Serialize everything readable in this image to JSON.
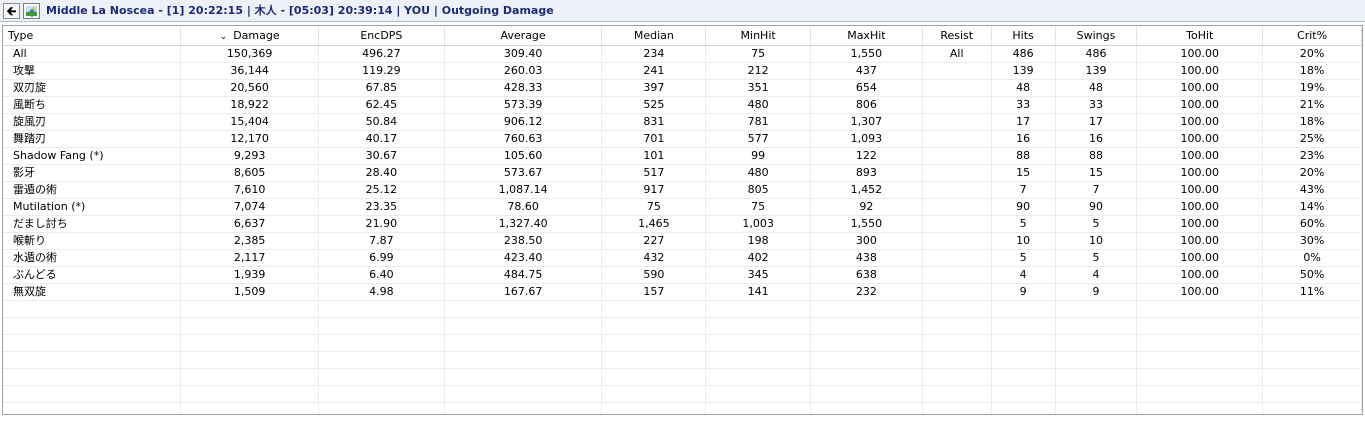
{
  "title": "Middle La Noscea - [1] 20:22:15 | 木人 - [05:03] 20:39:14 | YOU | Outgoing Damage",
  "icons": {
    "back": "back-arrow-icon",
    "image": "image-icon"
  },
  "columns": [
    "Type",
    "Damage",
    "EncDPS",
    "Average",
    "Median",
    "MinHit",
    "MaxHit",
    "Resist",
    "Hits",
    "Swings",
    "ToHit",
    "Crit%"
  ],
  "sorted_column": "Damage",
  "rows": [
    [
      "All",
      "150,369",
      "496.27",
      "309.40",
      "234",
      "75",
      "1,550",
      "All",
      "486",
      "486",
      "100.00",
      "20%"
    ],
    [
      "攻撃",
      "36,144",
      "119.29",
      "260.03",
      "241",
      "212",
      "437",
      "",
      "139",
      "139",
      "100.00",
      "18%"
    ],
    [
      "双刃旋",
      "20,560",
      "67.85",
      "428.33",
      "397",
      "351",
      "654",
      "",
      "48",
      "48",
      "100.00",
      "19%"
    ],
    [
      "風断ち",
      "18,922",
      "62.45",
      "573.39",
      "525",
      "480",
      "806",
      "",
      "33",
      "33",
      "100.00",
      "21%"
    ],
    [
      "旋風刃",
      "15,404",
      "50.84",
      "906.12",
      "831",
      "781",
      "1,307",
      "",
      "17",
      "17",
      "100.00",
      "18%"
    ],
    [
      "舞踏刃",
      "12,170",
      "40.17",
      "760.63",
      "701",
      "577",
      "1,093",
      "",
      "16",
      "16",
      "100.00",
      "25%"
    ],
    [
      "Shadow Fang (*)",
      "9,293",
      "30.67",
      "105.60",
      "101",
      "99",
      "122",
      "",
      "88",
      "88",
      "100.00",
      "23%"
    ],
    [
      "影牙",
      "8,605",
      "28.40",
      "573.67",
      "517",
      "480",
      "893",
      "",
      "15",
      "15",
      "100.00",
      "20%"
    ],
    [
      "雷遁の術",
      "7,610",
      "25.12",
      "1,087.14",
      "917",
      "805",
      "1,452",
      "",
      "7",
      "7",
      "100.00",
      "43%"
    ],
    [
      "Mutilation (*)",
      "7,074",
      "23.35",
      "78.60",
      "75",
      "75",
      "92",
      "",
      "90",
      "90",
      "100.00",
      "14%"
    ],
    [
      "だまし討ち",
      "6,637",
      "21.90",
      "1,327.40",
      "1,465",
      "1,003",
      "1,550",
      "",
      "5",
      "5",
      "100.00",
      "60%"
    ],
    [
      "喉斬り",
      "2,385",
      "7.87",
      "238.50",
      "227",
      "198",
      "300",
      "",
      "10",
      "10",
      "100.00",
      "30%"
    ],
    [
      "水遁の術",
      "2,117",
      "6.99",
      "423.40",
      "432",
      "402",
      "438",
      "",
      "5",
      "5",
      "100.00",
      "0%"
    ],
    [
      "ぶんどる",
      "1,939",
      "6.40",
      "484.75",
      "590",
      "345",
      "638",
      "",
      "4",
      "4",
      "100.00",
      "50%"
    ],
    [
      "無双旋",
      "1,509",
      "4.98",
      "167.67",
      "157",
      "141",
      "232",
      "",
      "9",
      "9",
      "100.00",
      "11%"
    ]
  ]
}
